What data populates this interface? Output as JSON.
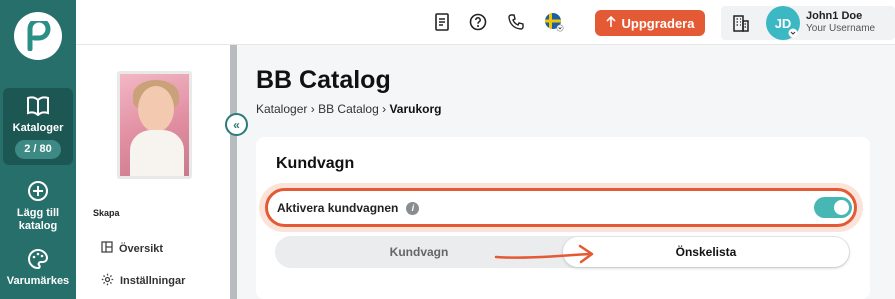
{
  "sidebar": {
    "items": [
      {
        "label": "Kataloger",
        "badge": "2 / 80",
        "icon": "book-open-icon"
      },
      {
        "label": "Lägg till katalog",
        "icon": "plus-circle-icon"
      },
      {
        "label": "Varumärkes",
        "icon": "palette-icon"
      }
    ]
  },
  "header": {
    "upgrade_label": "Uppgradera",
    "user_name": "John1 Doe",
    "user_sub": "Your Username",
    "avatar_initials": "JD",
    "icons": [
      "document-icon",
      "help-icon",
      "phone-icon",
      "swedish-flag-icon",
      "building-icon"
    ]
  },
  "subnav": {
    "section_label": "Skapa",
    "items": [
      {
        "label": "Översikt",
        "icon": "layout-icon"
      },
      {
        "label": "Inställningar",
        "icon": "gear-icon"
      }
    ]
  },
  "page": {
    "title": "BB Catalog",
    "breadcrumb": [
      "Kataloger",
      "BB Catalog",
      "Varukorg"
    ]
  },
  "card": {
    "title": "Kundvagn",
    "activate_label": "Aktivera kundvagnen",
    "toggle_on": true,
    "segments": [
      "Kundvagn",
      "Önskelista"
    ],
    "selected_segment": "Önskelista"
  },
  "colors": {
    "rail": "#276f6b",
    "accent": "#e35a35",
    "toggle": "#46b7b3",
    "avatar": "#3bb8c4"
  }
}
